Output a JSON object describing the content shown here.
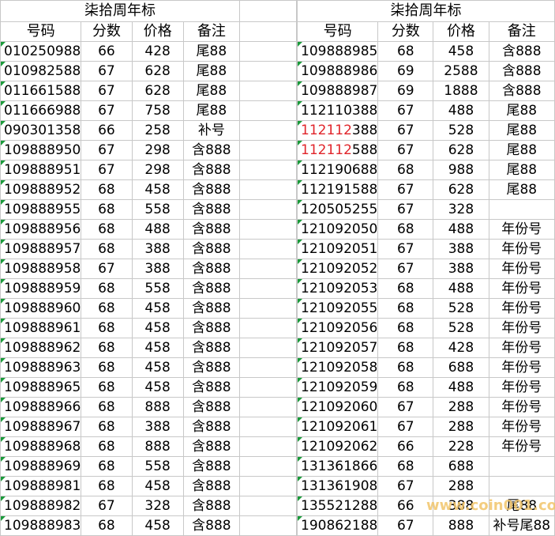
{
  "left": {
    "title": "柒拾周年标",
    "headers": [
      "号码",
      "分数",
      "价格",
      "备注"
    ],
    "rows": [
      [
        "010250988",
        "66",
        "428",
        "尾88"
      ],
      [
        "010982588",
        "67",
        "628",
        "尾88"
      ],
      [
        "011661588",
        "67",
        "628",
        "尾88"
      ],
      [
        "011666988",
        "67",
        "758",
        "尾88"
      ],
      [
        "090301358",
        "66",
        "258",
        "补号"
      ],
      [
        "109888950",
        "67",
        "298",
        "含888"
      ],
      [
        "109888951",
        "67",
        "298",
        "含888"
      ],
      [
        "109888952",
        "68",
        "458",
        "含888"
      ],
      [
        "109888955",
        "68",
        "558",
        "含888"
      ],
      [
        "109888956",
        "68",
        "488",
        "含888"
      ],
      [
        "109888957",
        "68",
        "388",
        "含888"
      ],
      [
        "109888958",
        "67",
        "388",
        "含888"
      ],
      [
        "109888959",
        "68",
        "558",
        "含888"
      ],
      [
        "109888960",
        "68",
        "458",
        "含888"
      ],
      [
        "109888961",
        "68",
        "458",
        "含888"
      ],
      [
        "109888962",
        "68",
        "458",
        "含888"
      ],
      [
        "109888963",
        "68",
        "458",
        "含888"
      ],
      [
        "109888965",
        "68",
        "458",
        "含888"
      ],
      [
        "109888966",
        "68",
        "888",
        "含888"
      ],
      [
        "109888967",
        "68",
        "388",
        "含888"
      ],
      [
        "109888968",
        "68",
        "888",
        "含888"
      ],
      [
        "109888969",
        "68",
        "558",
        "含888"
      ],
      [
        "109888981",
        "68",
        "458",
        "含888"
      ],
      [
        "109888982",
        "67",
        "328",
        "含888"
      ],
      [
        "109888983",
        "68",
        "458",
        "含888"
      ]
    ]
  },
  "right": {
    "title": "柒拾周年标",
    "headers": [
      "号码",
      "分数",
      "价格",
      "备注"
    ],
    "rows": [
      [
        "109888985",
        "68",
        "458",
        "含888"
      ],
      [
        "109888986",
        "69",
        "2588",
        "含888"
      ],
      [
        "109888987",
        "69",
        "1888",
        "含888"
      ],
      [
        "112110388",
        "67",
        "488",
        "尾88"
      ],
      [
        "112112388",
        "67",
        "528",
        "尾88"
      ],
      [
        "112112588",
        "67",
        "628",
        "尾88"
      ],
      [
        "112190688",
        "68",
        "988",
        "尾88"
      ],
      [
        "112191588",
        "67",
        "628",
        "尾88"
      ],
      [
        "120505255",
        "67",
        "328",
        ""
      ],
      [
        "121092050",
        "68",
        "488",
        "年份号"
      ],
      [
        "121092051",
        "67",
        "388",
        "年份号"
      ],
      [
        "121092052",
        "67",
        "388",
        "年份号"
      ],
      [
        "121092053",
        "68",
        "488",
        "年份号"
      ],
      [
        "121092055",
        "68",
        "528",
        "年份号"
      ],
      [
        "121092056",
        "68",
        "528",
        "年份号"
      ],
      [
        "121092057",
        "68",
        "428",
        "年份号"
      ],
      [
        "121092058",
        "68",
        "688",
        "年份号"
      ],
      [
        "121092059",
        "68",
        "488",
        "年份号"
      ],
      [
        "121092060",
        "67",
        "288",
        "年份号"
      ],
      [
        "121092061",
        "67",
        "288",
        "年份号"
      ],
      [
        "121092062",
        "66",
        "228",
        "年份号"
      ],
      [
        "131361866",
        "68",
        "688",
        ""
      ],
      [
        "131361908",
        "67",
        "288",
        ""
      ],
      [
        "135521288",
        "66",
        "388",
        "尾88"
      ],
      [
        "190862188",
        "67",
        "888",
        "补号尾88"
      ]
    ],
    "highlight_color": "#e0242a",
    "highlighted": [
      {
        "row": 4,
        "red_part": "112112",
        "rest": "388"
      },
      {
        "row": 5,
        "red_part": "112112",
        "rest": "588"
      }
    ]
  },
  "watermark": "www.coin001.com",
  "colors": {
    "grid": "#c8c8c8",
    "corner_marker": "#1a9a3a",
    "watermark": "#f2c56a"
  }
}
